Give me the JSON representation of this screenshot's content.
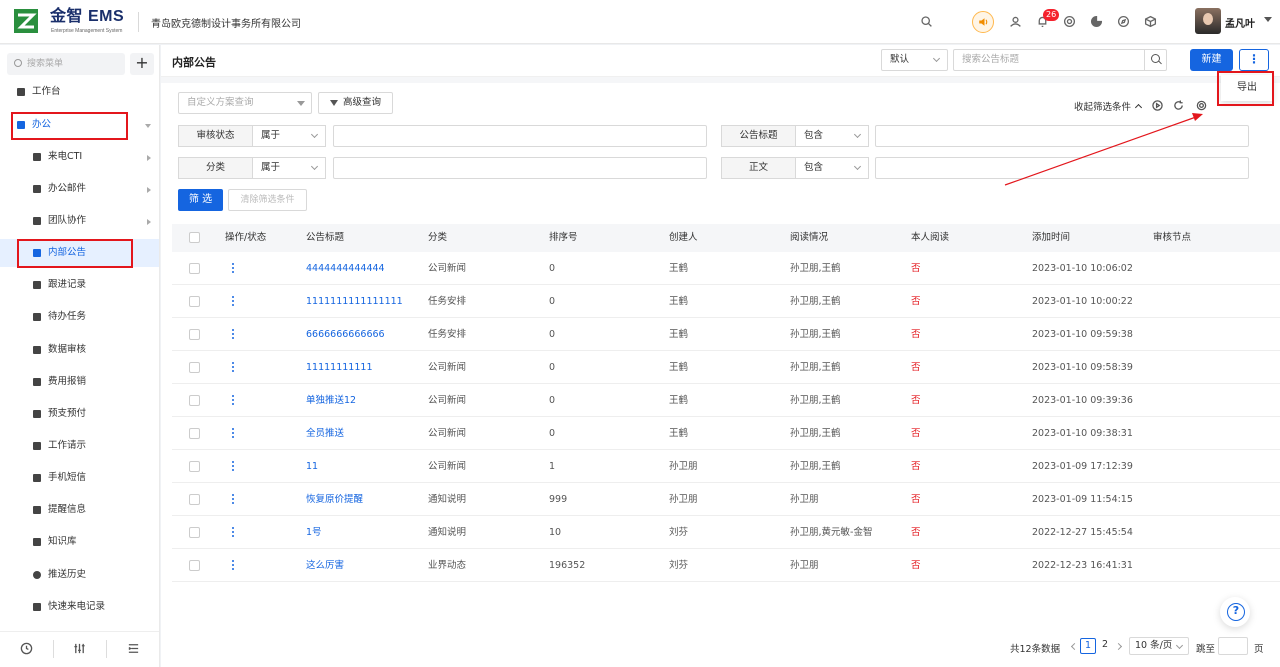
{
  "header": {
    "brand": "金智 EMS",
    "brand_sub": "Enterprise Management System",
    "company": "青岛欧克德制设计事务所有限公司",
    "notification_count": "26",
    "username": "孟凡叶"
  },
  "sidebar": {
    "search_placeholder": "搜索菜单",
    "add_label": "+",
    "items": [
      {
        "label": "工作台"
      },
      {
        "label": "办公"
      },
      {
        "label": "来电CTI"
      },
      {
        "label": "办公邮件"
      },
      {
        "label": "团队协作"
      },
      {
        "label": "内部公告"
      },
      {
        "label": "跟进记录"
      },
      {
        "label": "待办任务"
      },
      {
        "label": "数据审核"
      },
      {
        "label": "费用报销"
      },
      {
        "label": "预支预付"
      },
      {
        "label": "工作请示"
      },
      {
        "label": "手机短信"
      },
      {
        "label": "提醒信息"
      },
      {
        "label": "知识库"
      },
      {
        "label": "推送历史"
      },
      {
        "label": "快速来电记录"
      }
    ]
  },
  "page": {
    "title": "内部公告",
    "view_select": "默认",
    "search_placeholder": "搜索公告标题",
    "new_button": "新建",
    "more_button": "⋮",
    "export_item": "导出"
  },
  "filters": {
    "custom_query_placeholder": "自定义方案查询",
    "advanced_query": "高级查询",
    "collapse_label": "收起筛选条件",
    "rows": [
      {
        "label": "审核状态",
        "op": "属于"
      },
      {
        "label": "公告标题",
        "op": "包含"
      },
      {
        "label": "分类",
        "op": "属于"
      },
      {
        "label": "正文",
        "op": "包含"
      }
    ],
    "filter_button": "筛 选",
    "clear_button": "清除筛选条件"
  },
  "table": {
    "columns": [
      "操作/状态",
      "公告标题",
      "分类",
      "排序号",
      "创建人",
      "阅读情况",
      "本人阅读",
      "添加时间",
      "审核节点"
    ],
    "rows": [
      {
        "title": "4444444444444",
        "category": "公司新闻",
        "order": "0",
        "creator": "王鹤",
        "read": "孙卫朋,王鹤",
        "self_read": "否",
        "time": "2023-01-10 10:06:02"
      },
      {
        "title": "1111111111111111",
        "category": "任务安排",
        "order": "0",
        "creator": "王鹤",
        "read": "孙卫朋,王鹤",
        "self_read": "否",
        "time": "2023-01-10 10:00:22"
      },
      {
        "title": "6666666666666",
        "category": "任务安排",
        "order": "0",
        "creator": "王鹤",
        "read": "孙卫朋,王鹤",
        "self_read": "否",
        "time": "2023-01-10 09:59:38"
      },
      {
        "title": "11111111111",
        "category": "公司新闻",
        "order": "0",
        "creator": "王鹤",
        "read": "孙卫朋,王鹤",
        "self_read": "否",
        "time": "2023-01-10 09:58:39"
      },
      {
        "title": "单独推送12",
        "category": "公司新闻",
        "order": "0",
        "creator": "王鹤",
        "read": "孙卫朋,王鹤",
        "self_read": "否",
        "time": "2023-01-10 09:39:36"
      },
      {
        "title": "全员推送",
        "category": "公司新闻",
        "order": "0",
        "creator": "王鹤",
        "read": "孙卫朋,王鹤",
        "self_read": "否",
        "time": "2023-01-10 09:38:31"
      },
      {
        "title": "11",
        "category": "公司新闻",
        "order": "1",
        "creator": "孙卫朋",
        "read": "孙卫朋,王鹤",
        "self_read": "否",
        "time": "2023-01-09 17:12:39"
      },
      {
        "title": "恢复原价提醒",
        "category": "通知说明",
        "order": "999",
        "creator": "孙卫朋",
        "read": "孙卫朋",
        "self_read": "否",
        "time": "2023-01-09 11:54:15"
      },
      {
        "title": "1号",
        "category": "通知说明",
        "order": "10",
        "creator": "刘芬",
        "read": "孙卫朋,黄元敏-金智",
        "self_read": "否",
        "time": "2022-12-27 15:45:54"
      },
      {
        "title": "这么厉害",
        "category": "业界动态",
        "order": "196352",
        "creator": "刘芬",
        "read": "孙卫朋",
        "self_read": "否",
        "time": "2022-12-23 16:41:31"
      }
    ]
  },
  "pagination": {
    "total": "共12条数据",
    "pages": [
      "1",
      "2"
    ],
    "page_size": "10 条/页",
    "jump_label": "跳至",
    "page_unit": "页"
  },
  "colors": {
    "accent": "#1565e0",
    "highlight_red": "#e3161c"
  }
}
